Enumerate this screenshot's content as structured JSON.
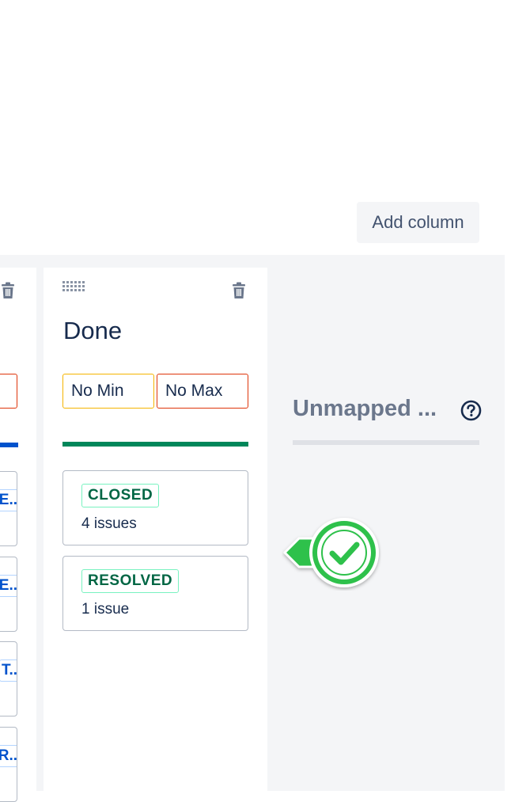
{
  "header": {
    "add_column_label": "Add column"
  },
  "columns": {
    "done": {
      "title": "Done",
      "min_label": "No Min",
      "max_label": "No Max",
      "statuses": [
        {
          "status": "CLOSED",
          "count": "4 issues"
        },
        {
          "status": "RESOLVED",
          "count": "1 issue"
        }
      ]
    },
    "previous_partial": {
      "card_fragments": [
        "E..",
        "E..",
        "T..",
        "R.."
      ]
    },
    "unmapped": {
      "title": "Unmapped ..."
    }
  },
  "colors": {
    "board_bg": "#f4f5f7",
    "done_bar": "#00875a",
    "inprogress_bar": "#0052cc",
    "min_border": "#f5b400",
    "max_border": "#de350b",
    "lozenge_text": "#006644",
    "check_badge": "#2ec14b"
  },
  "icons": [
    "trash-icon",
    "drag-grip-icon",
    "help-icon",
    "check-badge-icon"
  ]
}
